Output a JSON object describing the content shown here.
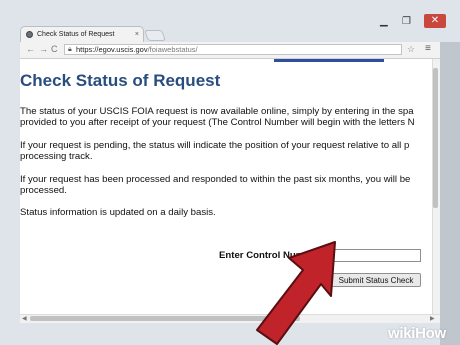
{
  "browser": {
    "tab_title": "Check Status of Request",
    "tab_close": "×",
    "url_host": "https://egov.uscis.gov",
    "url_path": "/foiawebstatus/",
    "window_controls": {
      "minimize": "▁",
      "maximize": "❐",
      "close": "✕"
    },
    "nav": {
      "back": "←",
      "forward": "→",
      "reload": "C"
    }
  },
  "page": {
    "title": "Check Status of Request",
    "paragraphs": [
      "The status of your USCIS FOIA request is now available online, simply by entering in the spa\nprovided to you after receipt of your request (The Control Number will begin with the letters N",
      "If your request is pending, the status will indicate the position of your request relative to all p\nprocessing track.",
      "If your request has been processed and responded to within the past six months, you will be\nprocessed.",
      "Status information is updated on a daily basis."
    ],
    "control_number_label": "Enter Control Number:",
    "control_number_value": "",
    "submit_label": "Submit Status Check"
  },
  "watermark": {
    "text": "wikiHow"
  },
  "colors": {
    "title": "#2a4d80",
    "arrow": "#c0232a",
    "chrome": "#dfe3ea"
  },
  "icons": {
    "favicon": "site-favicon",
    "lock": "lock-icon",
    "star": "bookmark-star-icon",
    "menu": "hamburger-menu-icon"
  }
}
